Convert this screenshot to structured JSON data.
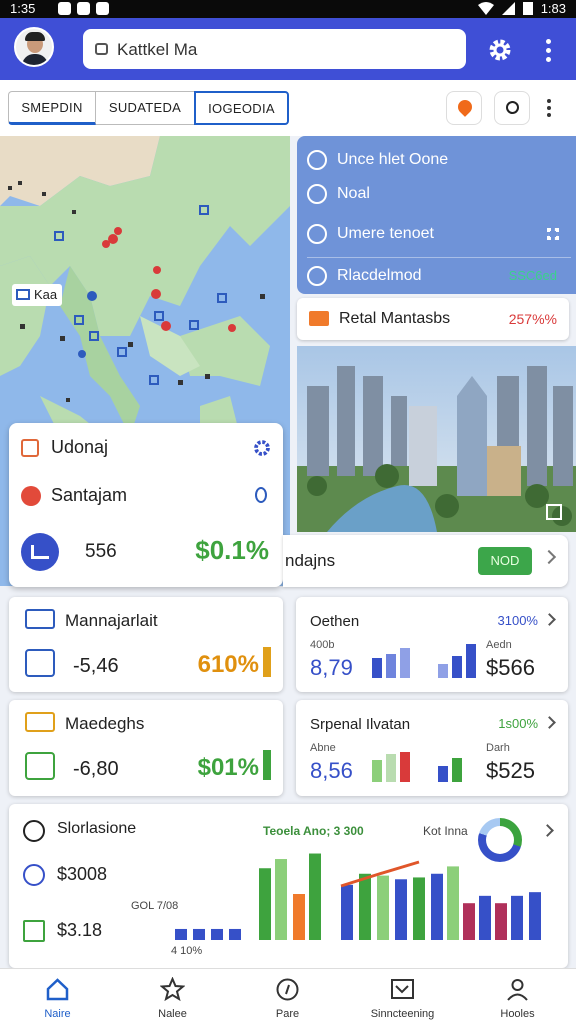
{
  "status_bar": {
    "time": "1:35",
    "right_time": "1:83"
  },
  "header": {
    "search_value": "Kattkel Ma"
  },
  "tabs": [
    {
      "label": "SMEPDIN"
    },
    {
      "label": "SUDATEDA"
    },
    {
      "label": "IOGEODIA"
    }
  ],
  "map": {
    "label": "Kaa"
  },
  "info_card": {
    "items": [
      {
        "label": "Unce hlet Oone"
      },
      {
        "label": "Noal"
      },
      {
        "label": "Umere tenoet"
      },
      {
        "label": "Rlacdelmod",
        "badge": "SSC6ed"
      }
    ]
  },
  "rental_bar": {
    "label": "Retal Mantasbs",
    "value": "257%%"
  },
  "left_card": {
    "row1": "Udonaj",
    "row2": "Santajam",
    "value": "556",
    "percent": "$0.1%"
  },
  "strip": {
    "label": "ndajns",
    "button": "NOD"
  },
  "metric_cards": [
    {
      "title": "Mannajarlait",
      "value": "-5,46",
      "percent": "610%",
      "percent_color": "#e0900e"
    },
    {
      "title": "Maedeghs",
      "value": "-6,80",
      "percent": "$01%",
      "percent_color": "#3ea33e"
    }
  ],
  "right_cards": [
    {
      "title": "Oethen",
      "badge": "3100%",
      "badge_color": "#3650c8",
      "sub1": "400b",
      "sub2": "Aedn",
      "value1": "8,79",
      "value2": "$566"
    },
    {
      "title": "Srpenal Ilvatan",
      "badge": "1s00%",
      "badge_color": "#3ea33e",
      "sub1": "Abne",
      "sub2": "Darh",
      "value1": "8,56",
      "value2": "$525"
    }
  ],
  "chart_card": {
    "title": "Slorlasione",
    "amount": "$3008",
    "small_value": "$3.18",
    "chart_title": "Teoela Ano; 3 300",
    "chart_label": "Kot Inna",
    "label1": "GOL 7/08",
    "label2": "4 10%"
  },
  "chart_data": {
    "type": "bar",
    "categories": [],
    "series": [
      {
        "values": [
          12,
          12,
          12,
          12,
          78,
          88,
          50,
          94,
          60,
          72,
          70,
          66,
          68,
          72,
          80,
          40,
          48,
          40,
          48,
          52
        ]
      }
    ]
  },
  "bottom_nav": [
    {
      "label": "Naire",
      "icon": "home-icon"
    },
    {
      "label": "Nalee",
      "icon": "star-icon"
    },
    {
      "label": "Pare",
      "icon": "compass-icon"
    },
    {
      "label": "Sinncteening",
      "icon": "chart-icon"
    },
    {
      "label": "Hooles",
      "icon": "person-icon"
    }
  ],
  "colors": {
    "primary": "#3f4fd6",
    "green": "#3ea33e",
    "blue": "#3650c8",
    "red": "#d93a3a",
    "orange": "#f07a2b"
  }
}
